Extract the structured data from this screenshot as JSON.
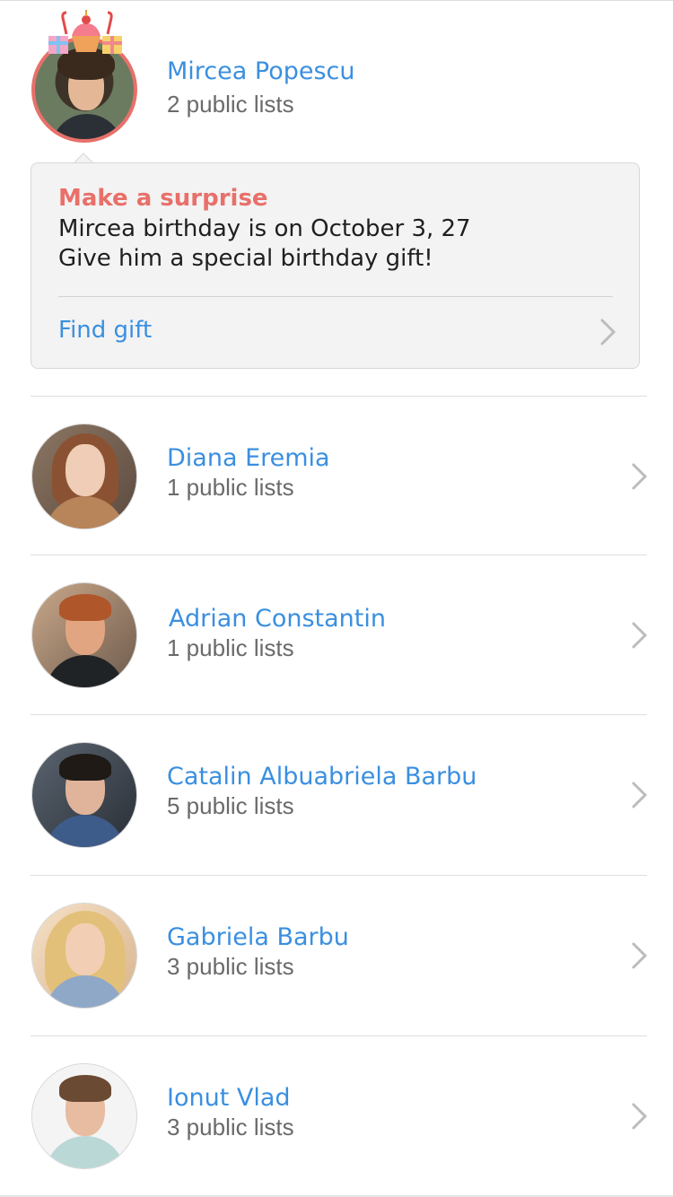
{
  "featured": {
    "name": "Mircea Popescu",
    "lists": "2 public lists",
    "avatar_icon": "birthday-party-icon",
    "ring_color": "#e8706a"
  },
  "surprise_card": {
    "title": "Make a surprise",
    "line1": "Mircea birthday is on October 3, 27",
    "line2": "Give him a special birthday gift!",
    "action_label": "Find gift"
  },
  "contacts": [
    {
      "name": "Diana Eremia",
      "lists": "1 public lists"
    },
    {
      "name": "Adrian Constantin",
      "lists": "1 public lists"
    },
    {
      "name": "Catalin Albuabriela Barbu",
      "lists": "5 public lists"
    },
    {
      "name": "Gabriela Barbu",
      "lists": "3 public lists"
    },
    {
      "name": "Ionut Vlad",
      "lists": "3 public lists"
    }
  ],
  "colors": {
    "accent": "#3a8fe0",
    "highlight": "#e8706a",
    "secondary_text": "#6a6a6a",
    "card_bg": "#f3f3f3"
  }
}
